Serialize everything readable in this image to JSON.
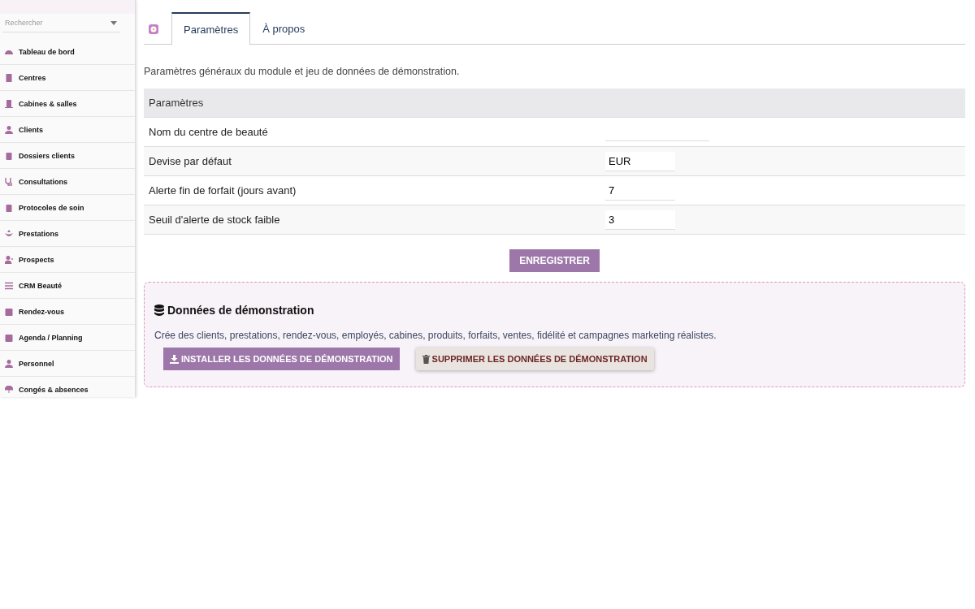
{
  "sidebar": {
    "search": {
      "placeholder": "Rechercher"
    },
    "items": [
      {
        "label": "Tableau de bord"
      },
      {
        "label": "Centres"
      },
      {
        "label": "Cabines & salles"
      },
      {
        "label": "Clients"
      },
      {
        "label": "Dossiers clients"
      },
      {
        "label": "Consultations"
      },
      {
        "label": "Protocoles de soin"
      },
      {
        "label": "Prestations"
      },
      {
        "label": "Prospects"
      },
      {
        "label": "CRM Beauté"
      },
      {
        "label": "Rendez-vous"
      },
      {
        "label": "Agenda / Planning"
      },
      {
        "label": "Personnel"
      },
      {
        "label": "Congés & absences"
      }
    ]
  },
  "tabs": [
    {
      "label": "Paramètres",
      "selected": true
    },
    {
      "label": "À propos",
      "selected": false
    }
  ],
  "intro": "Paramètres généraux du module et jeu de données de démonstration.",
  "table": {
    "heading": "Paramètres",
    "rows": [
      {
        "label": "Nom du centre de beauté",
        "value": ""
      },
      {
        "label": "Devise par défaut",
        "value": "EUR"
      },
      {
        "label": "Alerte fin de forfait (jours avant)",
        "value": "7"
      },
      {
        "label": "Seuil d'alerte de stock faible",
        "value": "3"
      }
    ]
  },
  "save_button": "ENREGISTRER",
  "demo": {
    "title": "Données de démonstration",
    "description": "Crée des clients, prestations, rendez-vous, employés, cabines, produits, forfaits, ventes, fidélité et campagnes marketing réalistes.",
    "install_button": "INSTALLER LES DONNÉES DE DÉMONSTRATION",
    "delete_button": "SUPPRIMER LES DONNÉES DE DÉMONSTRATION"
  }
}
